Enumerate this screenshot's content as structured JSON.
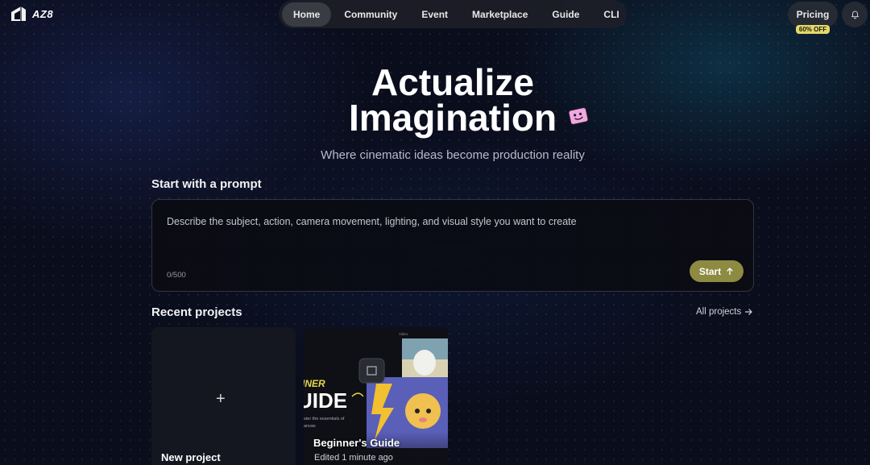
{
  "logo": {
    "text": "AZ8"
  },
  "nav": {
    "items": [
      "Home",
      "Community",
      "Event",
      "Marketplace",
      "Guide",
      "CLI"
    ],
    "active": "Home"
  },
  "header": {
    "pricing_label": "Pricing",
    "pricing_badge": "60% OFF"
  },
  "hero": {
    "title_line1": "Actualize",
    "title_line2": "Imagination",
    "subtitle": "Where cinematic ideas become production reality"
  },
  "prompt": {
    "section_label": "Start with a prompt",
    "placeholder": "Describe the subject, action, camera movement, lighting, and visual style you want to create",
    "counter": "0/500",
    "start_label": "Start"
  },
  "recent": {
    "section_label": "Recent projects",
    "all_label": "All projects",
    "new_project_label": "New project",
    "projects": [
      {
        "name": "Beginner's Guide",
        "meta": "Edited 1 minute ago",
        "thumb_text": "UIDE",
        "thumb_small": "INER"
      }
    ]
  },
  "colors": {
    "accent": "#8d8a42",
    "badge": "#e6d86a",
    "background": "#0a0d1c"
  }
}
